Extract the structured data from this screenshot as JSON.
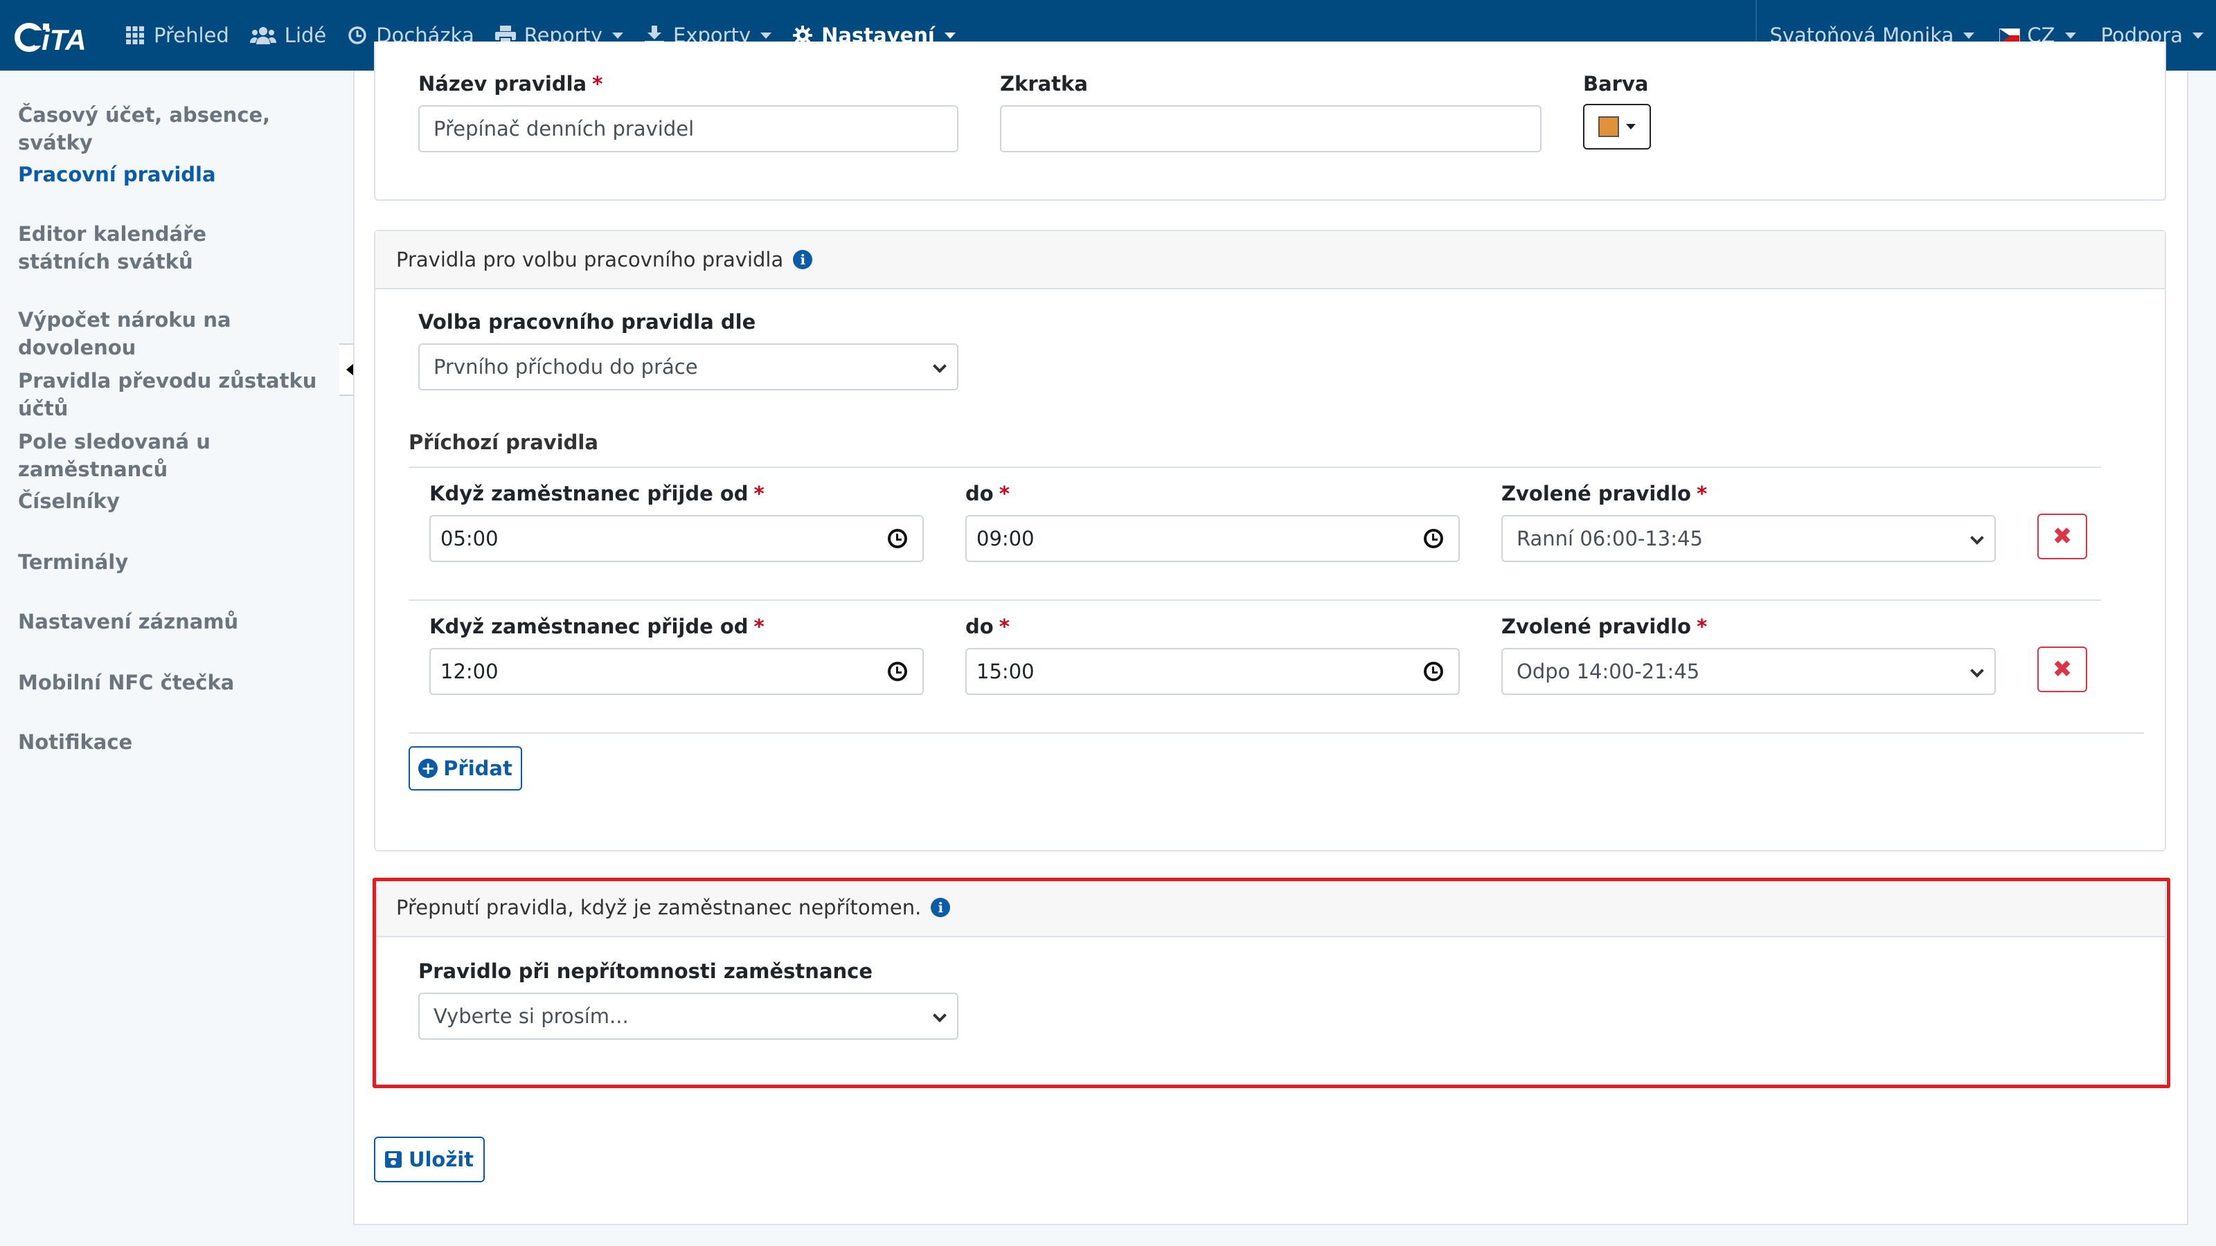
{
  "nav": {
    "logo_text": "iTA",
    "items": [
      {
        "label": "Přehled",
        "icon": "grid-icon"
      },
      {
        "label": "Lidé",
        "icon": "users-icon"
      },
      {
        "label": "Docházka",
        "icon": "clock-icon"
      },
      {
        "label": "Reporty",
        "icon": "print-icon"
      },
      {
        "label": "Exporty",
        "icon": "export-icon"
      },
      {
        "label": "Nastavení",
        "icon": "gear-icon"
      }
    ],
    "user": "Svatoňová Monika",
    "language": "CZ",
    "support": "Podpora"
  },
  "sidebar": {
    "items": [
      "Časový účet, absence, svátky",
      "Pracovní pravidla",
      "Editor kalendáře státních svátků",
      "Výpočet nároku na dovolenou",
      "Pravidla převodu zůstatku účtů",
      "Pole sledovaná u zaměstnanců",
      "Číselníky",
      "Terminály",
      "Nastavení záznamů",
      "Mobilní NFC čtečka",
      "Notifikace"
    ],
    "active_index": 1
  },
  "rule_form": {
    "name_label": "Název pravidla",
    "name_value": "Přepínač denních pravidel",
    "abbr_label": "Zkratka",
    "abbr_value": "",
    "color_label": "Barva",
    "color_value": "#e0913a",
    "required_mark": "*"
  },
  "selection_card": {
    "header": "Pravidla pro volbu pracovního pravidla",
    "select_label": "Volba pracovního pravidla dle",
    "select_value": "Prvního příchodu do práce",
    "section_title": "Příchozí pravidla",
    "from_label": "Když zaměstnanec přijde od",
    "to_label": "do",
    "rule_label": "Zvolené pravidlo",
    "rows": [
      {
        "from": "05:00",
        "to": "09:00",
        "rule": "Ranní 06:00-13:45"
      },
      {
        "from": "12:00",
        "to": "15:00",
        "rule": "Odpo 14:00-21:45"
      }
    ],
    "add_button": "Přidat",
    "delete_symbol": "✖"
  },
  "absence_card": {
    "header": "Přepnutí pravidla, když je zaměstnanec nepřítomen.",
    "select_label": "Pravidlo při nepřítomnosti zaměstnance",
    "select_value": "Vyberte si prosím..."
  },
  "save_button": "Uložit",
  "info_symbol": "i"
}
